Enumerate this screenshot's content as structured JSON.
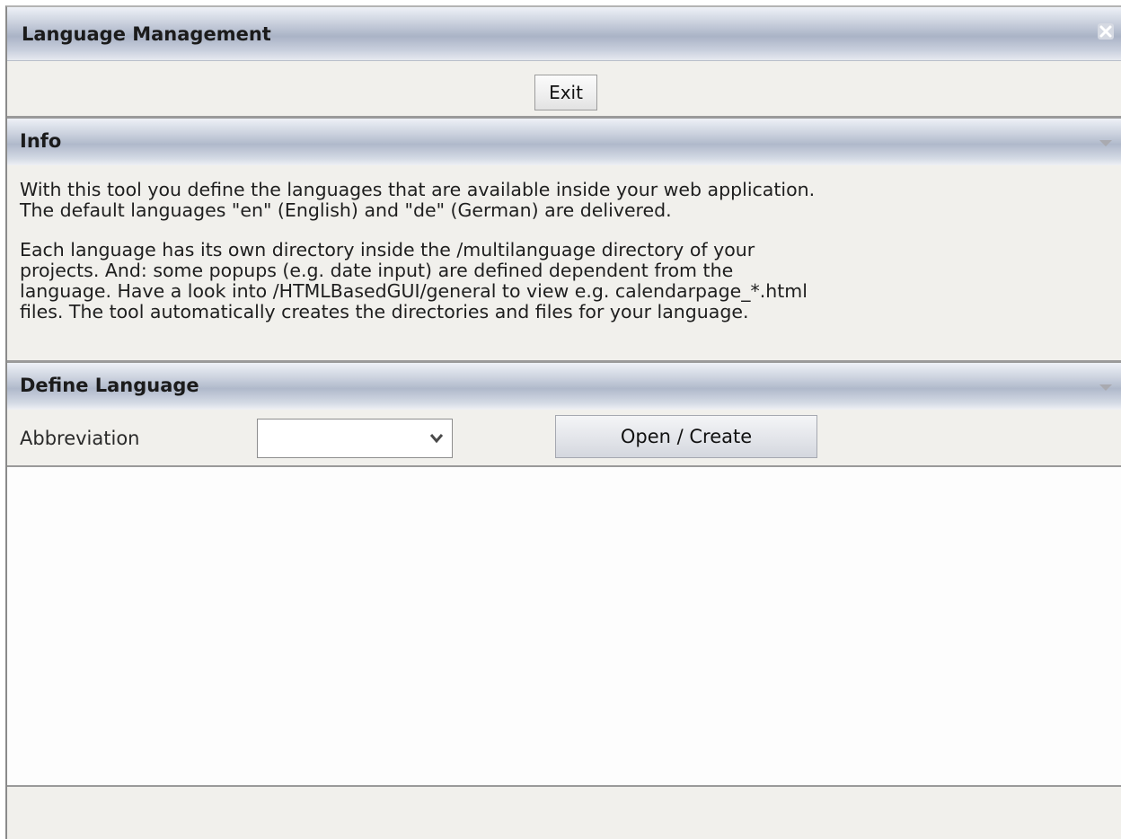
{
  "window": {
    "title": "Language Management"
  },
  "toolbar": {
    "exit_label": "Exit"
  },
  "info": {
    "title": "Info",
    "paragraph1": "With this tool you define the languages that are available inside your web application.\nThe default languages \"en\" (English) and \"de\" (German) are delivered.",
    "paragraph2": "Each language has its own directory inside the /multilanguage directory of your\nprojects. And: some popups (e.g. date input) are defined dependent from the\nlanguage. Have a look into /HTMLBasedGUI/general to view e.g. calendarpage_*.html\nfiles. The tool automatically creates the directories and files for your language."
  },
  "define_language": {
    "title": "Define Language",
    "abbreviation_label": "Abbreviation",
    "abbreviation_value": "",
    "open_create_label": "Open / Create"
  },
  "icons": {
    "close": "close-icon",
    "collapse": "collapse-icon",
    "dropdown": "chevron-down-icon"
  }
}
